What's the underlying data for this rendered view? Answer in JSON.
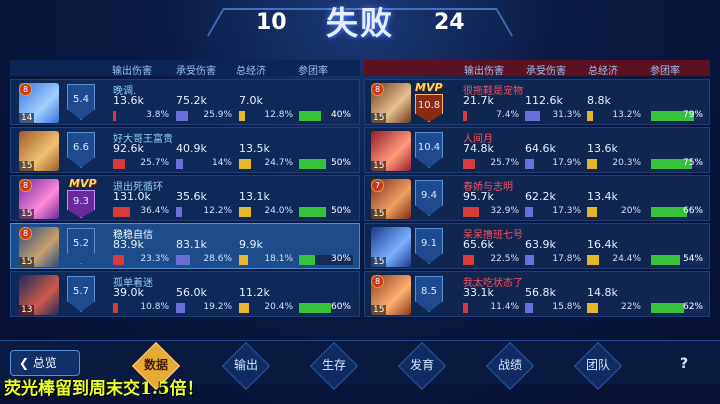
{
  "header": {
    "result": "失败",
    "score_left": "10",
    "score_right": "24"
  },
  "columns": {
    "left": [
      "输出伤害",
      "承受伤害",
      "总经济",
      "参团率"
    ],
    "right": [
      "输出伤害",
      "承受伤害",
      "总经济",
      "参团率"
    ]
  },
  "left_team": [
    {
      "name": "晚调.",
      "rank": "5.4",
      "level": "14",
      "badge": "8",
      "dmg": "13.6k",
      "dmg_pct": "3.8%",
      "dmg_frac": 0.038,
      "taken": "75.2k",
      "taken_pct": "25.9%",
      "taken_frac": 0.259,
      "gold": "7.0k",
      "gold_pct": "12.8%",
      "gold_frac": 0.128,
      "kp": "40%",
      "kp_frac": 0.4,
      "mvp": "",
      "me": false
    },
    {
      "name": "好大哥王富贵",
      "rank": "6.6",
      "level": "15",
      "badge": "",
      "dmg": "92.6k",
      "dmg_pct": "25.7%",
      "dmg_frac": 0.257,
      "taken": "40.9k",
      "taken_pct": "14%",
      "taken_frac": 0.14,
      "gold": "13.5k",
      "gold_pct": "24.7%",
      "gold_frac": 0.247,
      "kp": "50%",
      "kp_frac": 0.5,
      "mvp": "",
      "me": false
    },
    {
      "name": "退出死循环",
      "rank": "9.3",
      "level": "15",
      "badge": "8",
      "dmg": "131.0k",
      "dmg_pct": "36.4%",
      "dmg_frac": 0.364,
      "taken": "35.6k",
      "taken_pct": "12.2%",
      "taken_frac": 0.122,
      "gold": "13.1k",
      "gold_pct": "24.0%",
      "gold_frac": 0.24,
      "kp": "50%",
      "kp_frac": 0.5,
      "mvp": "MVP",
      "me": false
    },
    {
      "name": "稳稳自信",
      "rank": "5.2",
      "level": "15",
      "badge": "8",
      "dmg": "83.9k",
      "dmg_pct": "23.3%",
      "dmg_frac": 0.233,
      "taken": "83.1k",
      "taken_pct": "28.6%",
      "taken_frac": 0.286,
      "gold": "9.9k",
      "gold_pct": "18.1%",
      "gold_frac": 0.181,
      "kp": "30%",
      "kp_frac": 0.3,
      "mvp": "",
      "me": true
    },
    {
      "name": "孤单着迷",
      "rank": "5.7",
      "level": "13",
      "badge": "",
      "dmg": "39.0k",
      "dmg_pct": "10.8%",
      "dmg_frac": 0.108,
      "taken": "56.0k",
      "taken_pct": "19.2%",
      "taken_frac": 0.192,
      "gold": "11.2k",
      "gold_pct": "20.4%",
      "gold_frac": 0.204,
      "kp": "60%",
      "kp_frac": 0.6,
      "mvp": "",
      "me": false
    }
  ],
  "right_team": [
    {
      "name": "很拖鞋是宠物",
      "rank": "10.8",
      "level": "15",
      "badge": "8",
      "dmg": "21.7k",
      "dmg_pct": "7.4%",
      "dmg_frac": 0.074,
      "taken": "112.6k",
      "taken_pct": "31.3%",
      "taken_frac": 0.313,
      "gold": "8.8k",
      "gold_pct": "13.2%",
      "gold_frac": 0.132,
      "kp": "79%",
      "kp_frac": 0.79,
      "mvp": "MVP"
    },
    {
      "name": "人间月",
      "rank": "10.4",
      "level": "15",
      "badge": "",
      "dmg": "74.8k",
      "dmg_pct": "25.7%",
      "dmg_frac": 0.257,
      "taken": "64.6k",
      "taken_pct": "17.9%",
      "taken_frac": 0.179,
      "gold": "13.6k",
      "gold_pct": "20.3%",
      "gold_frac": 0.203,
      "kp": "75%",
      "kp_frac": 0.75,
      "mvp": ""
    },
    {
      "name": "春娇与志明",
      "rank": "9.4",
      "level": "15",
      "badge": "7",
      "dmg": "95.7k",
      "dmg_pct": "32.9%",
      "dmg_frac": 0.329,
      "taken": "62.2k",
      "taken_pct": "17.3%",
      "taken_frac": 0.173,
      "gold": "13.4k",
      "gold_pct": "20%",
      "gold_frac": 0.2,
      "kp": "66%",
      "kp_frac": 0.66,
      "mvp": ""
    },
    {
      "name": "呆呆撸班七号",
      "rank": "9.1",
      "level": "15",
      "badge": "",
      "dmg": "65.6k",
      "dmg_pct": "22.5%",
      "dmg_frac": 0.225,
      "taken": "63.9k",
      "taken_pct": "17.8%",
      "taken_frac": 0.178,
      "gold": "16.4k",
      "gold_pct": "24.4%",
      "gold_frac": 0.244,
      "kp": "54%",
      "kp_frac": 0.54,
      "mvp": ""
    },
    {
      "name": "我太吃状态了",
      "rank": "8.5",
      "level": "15",
      "badge": "8",
      "dmg": "33.1k",
      "dmg_pct": "11.4%",
      "dmg_frac": 0.114,
      "taken": "56.8k",
      "taken_pct": "15.8%",
      "taken_frac": 0.158,
      "gold": "14.8k",
      "gold_pct": "22%",
      "gold_frac": 0.22,
      "kp": "62%",
      "kp_frac": 0.62,
      "mvp": ""
    }
  ],
  "bottom": {
    "back_label": "总览",
    "tabs": [
      "数据",
      "输出",
      "生存",
      "发育",
      "战绩",
      "团队"
    ],
    "active_tab": "数据",
    "help": "?"
  },
  "caption": "荧光棒留到周末交1.5倍！",
  "colors": {
    "damage": "#d83a3a",
    "taken": "#6b6fd8",
    "gold": "#e8b62c",
    "kp": "#37c23b",
    "enemy_name": "#ff4d5e",
    "ally_name": "#8fd0ff"
  }
}
